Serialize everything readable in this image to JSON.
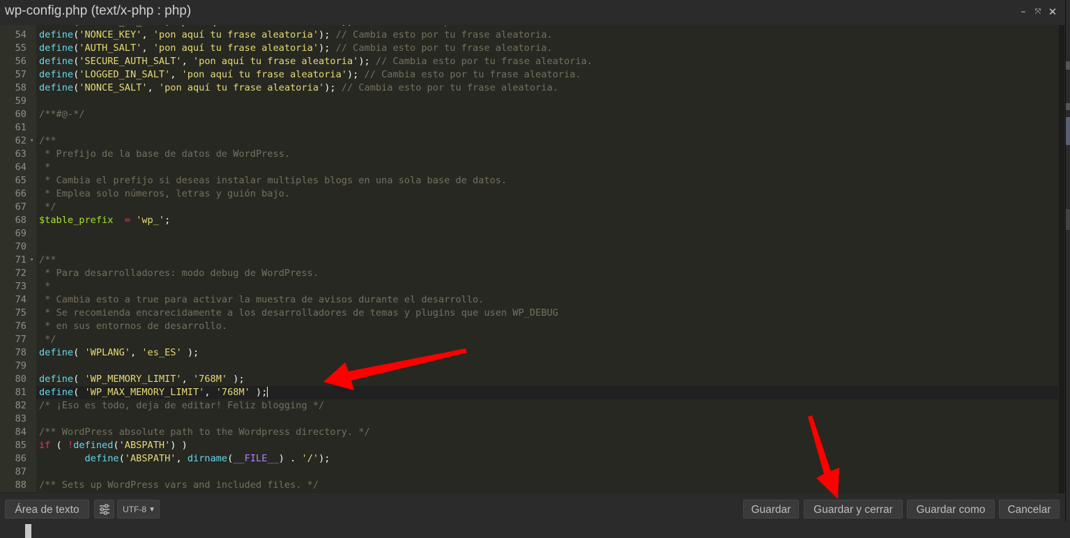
{
  "window": {
    "title": "wp-config.php (text/x-php : php)",
    "minimize_glyph": "–",
    "maximize_glyph": "⤧",
    "close_glyph": "✕"
  },
  "editor": {
    "partial_first_line": "define('LOGGED_IN_KEY', 'pon aquí tu frase aleatoria'); // Cambia esto por tu frase aleatoria.",
    "lines": [
      {
        "n": "54",
        "code": "define('NONCE_KEY', 'pon aquí tu frase aleatoria'); // Cambia esto por tu frase aleatoria."
      },
      {
        "n": "55",
        "code": "define('AUTH_SALT', 'pon aquí tu frase aleatoria'); // Cambia esto por tu frase aleatoria."
      },
      {
        "n": "56",
        "code": "define('SECURE_AUTH_SALT', 'pon aquí tu frase aleatoria'); // Cambia esto por tu frase aleatoria."
      },
      {
        "n": "57",
        "code": "define('LOGGED_IN_SALT', 'pon aquí tu frase aleatoria'); // Cambia esto por tu frase aleatoria."
      },
      {
        "n": "58",
        "code": "define('NONCE_SALT', 'pon aquí tu frase aleatoria'); // Cambia esto por tu frase aleatoria."
      },
      {
        "n": "59",
        "code": ""
      },
      {
        "n": "60",
        "code": "/**#@-*/"
      },
      {
        "n": "61",
        "code": ""
      },
      {
        "n": "62",
        "code": "/**",
        "fold": true
      },
      {
        "n": "63",
        "code": " * Prefijo de la base de datos de WordPress."
      },
      {
        "n": "64",
        "code": " *"
      },
      {
        "n": "65",
        "code": " * Cambia el prefijo si deseas instalar multiples blogs en una sola base de datos."
      },
      {
        "n": "66",
        "code": " * Emplea solo números, letras y guión bajo."
      },
      {
        "n": "67",
        "code": " */"
      },
      {
        "n": "68",
        "code": "$table_prefix  = 'wp_';"
      },
      {
        "n": "69",
        "code": ""
      },
      {
        "n": "70",
        "code": ""
      },
      {
        "n": "71",
        "code": "/**",
        "fold": true
      },
      {
        "n": "72",
        "code": " * Para desarrolladores: modo debug de WordPress."
      },
      {
        "n": "73",
        "code": " *"
      },
      {
        "n": "74",
        "code": " * Cambia esto a true para activar la muestra de avisos durante el desarrollo."
      },
      {
        "n": "75",
        "code": " * Se recomienda encarecidamente a los desarrolladores de temas y plugins que usen WP_DEBUG"
      },
      {
        "n": "76",
        "code": " * en sus entornos de desarrollo."
      },
      {
        "n": "77",
        "code": " */"
      },
      {
        "n": "78",
        "code": "define( 'WPLANG', 'es_ES' );"
      },
      {
        "n": "79",
        "code": ""
      },
      {
        "n": "80",
        "code": "define( 'WP_MEMORY_LIMIT', '768M' );"
      },
      {
        "n": "81",
        "code": "define( 'WP_MAX_MEMORY_LIMIT', '768M' );",
        "active": true
      },
      {
        "n": "82",
        "code": "/* ¡Eso es todo, deja de editar! Feliz blogging */"
      },
      {
        "n": "83",
        "code": ""
      },
      {
        "n": "84",
        "code": "/** WordPress absolute path to the Wordpress directory. */"
      },
      {
        "n": "85",
        "code": "if ( !defined('ABSPATH') )"
      },
      {
        "n": "86",
        "code": "\tdefine('ABSPATH', dirname(__FILE__) . '/');"
      },
      {
        "n": "87",
        "code": ""
      },
      {
        "n": "88",
        "code": "/** Sets up WordPress vars and included files. */"
      }
    ]
  },
  "footer": {
    "textarea_label": "Área de texto",
    "encoding_value": "UTF-8",
    "save_label": "Guardar",
    "save_close_label": "Guardar y cerrar",
    "save_as_label": "Guardar como",
    "cancel_label": "Cancelar"
  },
  "colors": {
    "background": "#272822",
    "keyword": "#66d9ef",
    "string": "#e6db74",
    "comment": "#75715e",
    "variable": "#a6e22e",
    "operator": "#f92672",
    "annotation_arrow": "#ff0000"
  },
  "annotations": [
    {
      "type": "arrow",
      "points_to": "line 80-81"
    },
    {
      "type": "arrow",
      "points_to": "Guardar y cerrar"
    }
  ]
}
